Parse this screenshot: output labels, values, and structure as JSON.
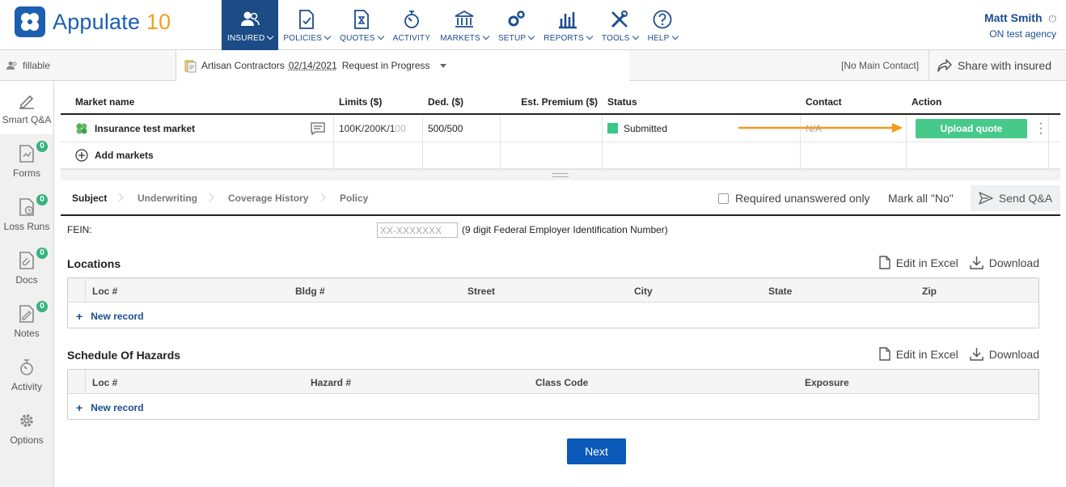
{
  "app": {
    "name": "Appulate",
    "name_num": "10"
  },
  "nav": [
    {
      "label": "INSURED",
      "icon": "insured-icon"
    },
    {
      "label": "POLICIES",
      "icon": "policies-icon"
    },
    {
      "label": "QUOTES",
      "icon": "quotes-icon"
    },
    {
      "label": "ACTIVITY",
      "icon": "activity-icon"
    },
    {
      "label": "MARKETS",
      "icon": "markets-icon"
    },
    {
      "label": "SETUP",
      "icon": "setup-icon"
    },
    {
      "label": "REPORTS",
      "icon": "reports-icon"
    },
    {
      "label": "TOOLS",
      "icon": "tools-icon"
    },
    {
      "label": "HELP",
      "icon": "help-icon"
    }
  ],
  "user": {
    "name": "Matt Smith",
    "agency": "ON test agency"
  },
  "subbar": {
    "workspace": "fillable",
    "insured": "Artisan Contractors",
    "date": "02/14/2021",
    "status": "Request in Progress",
    "no_contact": "[No Main Contact]",
    "share": "Share with insured"
  },
  "sidebar": [
    {
      "label": "Smart Q&A",
      "icon": "smart-qa-icon"
    },
    {
      "label": "Forms",
      "icon": "forms-icon",
      "badge": "0"
    },
    {
      "label": "Loss Runs",
      "icon": "loss-runs-icon",
      "badge": "0"
    },
    {
      "label": "Docs",
      "icon": "docs-icon",
      "badge": "0"
    },
    {
      "label": "Notes",
      "icon": "notes-icon",
      "badge": "0"
    },
    {
      "label": "Activity",
      "icon": "activity-icon"
    },
    {
      "label": "Options",
      "icon": "options-icon"
    }
  ],
  "markets": {
    "headers": [
      "Market name",
      "Limits ($)",
      "Ded. ($)",
      "Est. Premium ($)",
      "Status",
      "Contact",
      "Action"
    ],
    "rows": [
      {
        "name": "Insurance test market",
        "limits": "100K/200K/100",
        "limits_main": "100K/200K/1",
        "limits_fade": "00",
        "ded": "500/500",
        "premium": "",
        "status": "Submitted",
        "contact": "N/A",
        "action": "Upload quote"
      }
    ],
    "add_label": "Add markets",
    "status_color": "#39c78a"
  },
  "tabs": {
    "items": [
      "Subject",
      "Underwriting",
      "Coverage History",
      "Policy"
    ],
    "required_only": "Required unanswered only",
    "mark_all": "Mark all \"No\"",
    "send": "Send Q&A"
  },
  "form": {
    "fein_label": "FEIN:",
    "fein_placeholder": "XX-XXXXXXX",
    "fein_hint": "(9 digit Federal Employer Identification Number)"
  },
  "locations": {
    "title": "Locations",
    "edit": "Edit in Excel",
    "download": "Download",
    "columns": [
      "Loc #",
      "Bldg #",
      "Street",
      "City",
      "State",
      "Zip"
    ],
    "new_record": "New record"
  },
  "hazards": {
    "title": "Schedule Of Hazards",
    "edit": "Edit in Excel",
    "download": "Download",
    "columns": [
      "Loc #",
      "Hazard #",
      "Class Code",
      "Exposure"
    ],
    "new_record": "New record"
  },
  "next_label": "Next",
  "colors": {
    "brand": "#1b5fb0",
    "nav_active": "#1c4b86",
    "accent_orange": "#f39a1e",
    "success": "#47c98a",
    "primary_button": "#0b59b8"
  }
}
